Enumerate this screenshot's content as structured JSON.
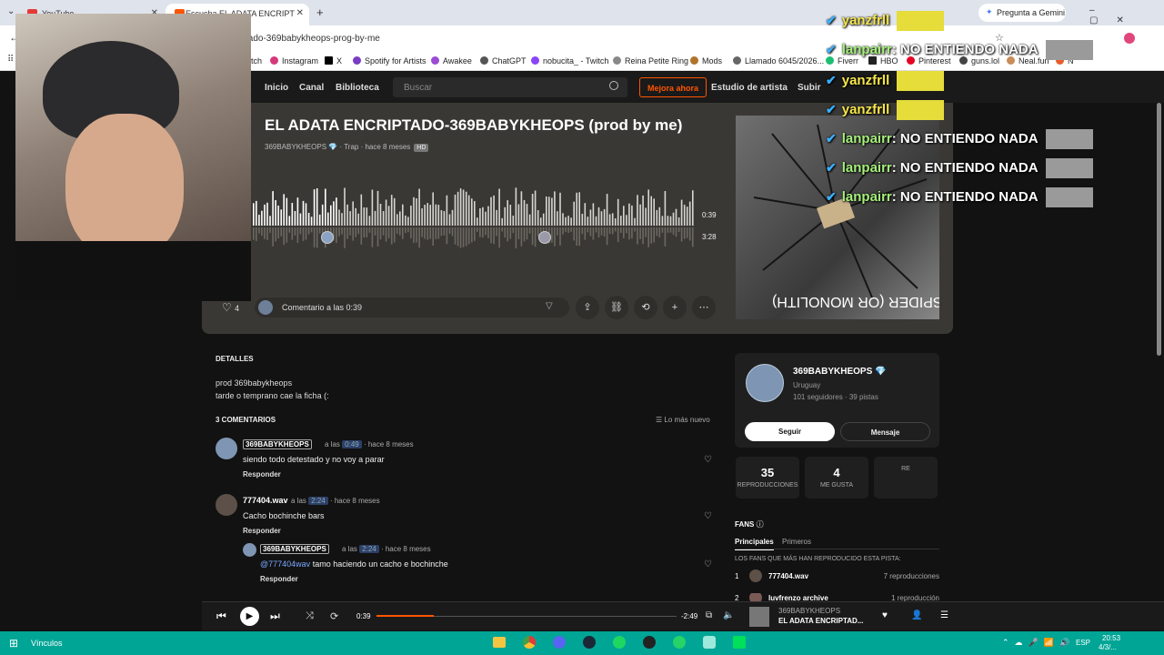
{
  "browser": {
    "tabs": [
      {
        "label": "YouTube",
        "active": false
      },
      {
        "label": "Escucha EL ADATA ENCRIPT",
        "active": true
      }
    ],
    "url": "tado-369babykheops-prog-by-me",
    "gemini_label": "Pregunta a Gemini",
    "bookmarks": [
      "tch",
      "Instagram",
      "X",
      "Spotify for Artists",
      "Awakee",
      "ChatGPT",
      "nobucita_ - Twitch",
      "Reina Petite Ring",
      "Mods",
      "Llamado 6045/2026...",
      "Fiverr",
      "HBO",
      "Pinterest",
      "guns.lol",
      "Neal.fun",
      "N"
    ]
  },
  "site": {
    "nav": [
      "Inicio",
      "Canal",
      "Biblioteca"
    ],
    "search_placeholder": "Buscar",
    "upgrade_label": "Mejora ahora",
    "studio_label": "Estudio de artista",
    "upload_label": "Subir"
  },
  "track": {
    "title": "EL ADATA ENCRIPTADO-369BABYKHEOPS (prod by me)",
    "artist": "369BABYKHEOPS",
    "genre": "Trap",
    "posted": "hace 8 meses",
    "badge": "HD",
    "time_current": "0:39",
    "time_total": "3:28",
    "progress": 0.19,
    "likes": "4",
    "comment_placeholder": "Comentario a las 0:39",
    "art_text": "SPIDER (OR MONOLITH)"
  },
  "details": {
    "heading": "DETALLES",
    "lines": [
      "prod 369babykheops",
      "tarde o temprano cae la ficha (:"
    ]
  },
  "comments": {
    "heading": "3 COMENTARIOS",
    "sort_label": "Lo más nuevo",
    "reply_label": "Responder",
    "at_label": "a las",
    "items": [
      {
        "user": "369BABYKHEOPS",
        "time": "0:49",
        "ago": "hace 8 meses",
        "text": "siendo todo detestado y no voy a parar"
      },
      {
        "user": "777404.wav",
        "time": "2:24",
        "ago": "hace 8 meses",
        "text": "Cacho bochinche bars"
      },
      {
        "user": "369BABYKHEOPS",
        "time": "2:24",
        "ago": "hace 8 meses",
        "mention": "@777404wav",
        "text": " tamo haciendo un cacho e bochinche"
      }
    ]
  },
  "artist_card": {
    "name": "369BABYKHEOPS",
    "country": "Uruguay",
    "followers": "101 seguidores",
    "tracks": "39 pistas",
    "follow_label": "Seguir",
    "message_label": "Mensaje",
    "stats": [
      {
        "value": "35",
        "label": "REPRODUCCIONES"
      },
      {
        "value": "4",
        "label": "ME GUSTA"
      },
      {
        "value": "",
        "label": "RE"
      }
    ]
  },
  "fans": {
    "heading": "FANS",
    "tabs": [
      "Principales",
      "Primeros"
    ],
    "subtitle": "LOS FANS QUE MÁS HAN REPRODUCIDO ESTA PISTA:",
    "items": [
      {
        "rank": "1",
        "name": "777404.wav",
        "plays": "7 reproducciones"
      },
      {
        "rank": "2",
        "name": "luvfrenzo archive",
        "plays": "1 reproducción"
      }
    ]
  },
  "player": {
    "current": "0:39",
    "remaining": "-2:49",
    "progress": 0.19,
    "artist": "369BABYKHEOPS",
    "title": "EL ADATA ENCRIPTAD..."
  },
  "taskbar": {
    "search_label": "Vínculos",
    "lang": "ESP",
    "clock": "20:53",
    "date": "4/3/..."
  },
  "stream_chat": [
    {
      "user": "yanzfrll",
      "text": "",
      "color": "yellow"
    },
    {
      "user": "lanpairr",
      "text": "NO ENTIENDO NADA",
      "color": "green"
    },
    {
      "user": "yanzfrll",
      "text": "",
      "color": "yellow"
    },
    {
      "user": "yanzfrll",
      "text": "",
      "color": "yellow"
    },
    {
      "user": "lanpairr",
      "text": "NO ENTIENDO NADA",
      "color": "green"
    },
    {
      "user": "lanpairr",
      "text": "NO ENTIENDO NADA",
      "color": "green"
    },
    {
      "user": "lanpairr",
      "text": "NO ENTIENDO NADA",
      "color": "green"
    }
  ],
  "colors": {
    "accent": "#ff5500",
    "taskbar": "#00a596",
    "hero": "#3a3834"
  }
}
